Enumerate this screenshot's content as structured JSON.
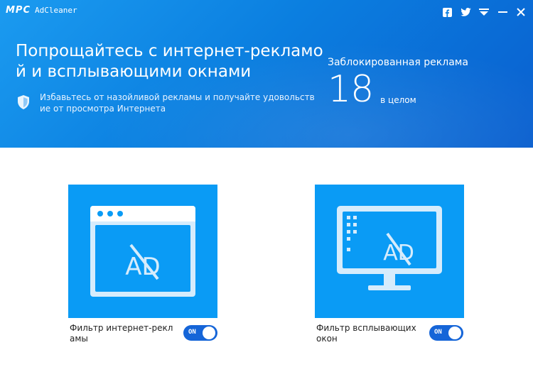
{
  "app": {
    "logo_mark": "MPC",
    "title": "AdCleaner"
  },
  "window_controls": {
    "icons": [
      "facebook-icon",
      "twitter-icon",
      "menu-icon",
      "minimize-icon",
      "close-icon"
    ]
  },
  "header": {
    "headline": "Попрощайтесь с интернет-рекламой и всплывающими окнами",
    "subtext": "Избавьтесь от назойливой рекламы и получайте удовольствие от просмотра Интернета",
    "stats_label": "Заблокированная реклама",
    "blocked_count": "18",
    "stats_unit": "в целом"
  },
  "filters": [
    {
      "label": "Фильтр интернет-рекламы",
      "toggle_text": "ON",
      "enabled": true,
      "icon": "browser-ad-icon",
      "ad_text": "AD"
    },
    {
      "label": "Фильтр всплывающих окон",
      "toggle_text": "ON",
      "enabled": true,
      "icon": "monitor-ad-icon",
      "ad_text": "AD"
    }
  ],
  "colors": {
    "header_blue": "#0b7fe0",
    "card_blue": "#0a9bf5",
    "toggle_blue": "#1565d8"
  }
}
